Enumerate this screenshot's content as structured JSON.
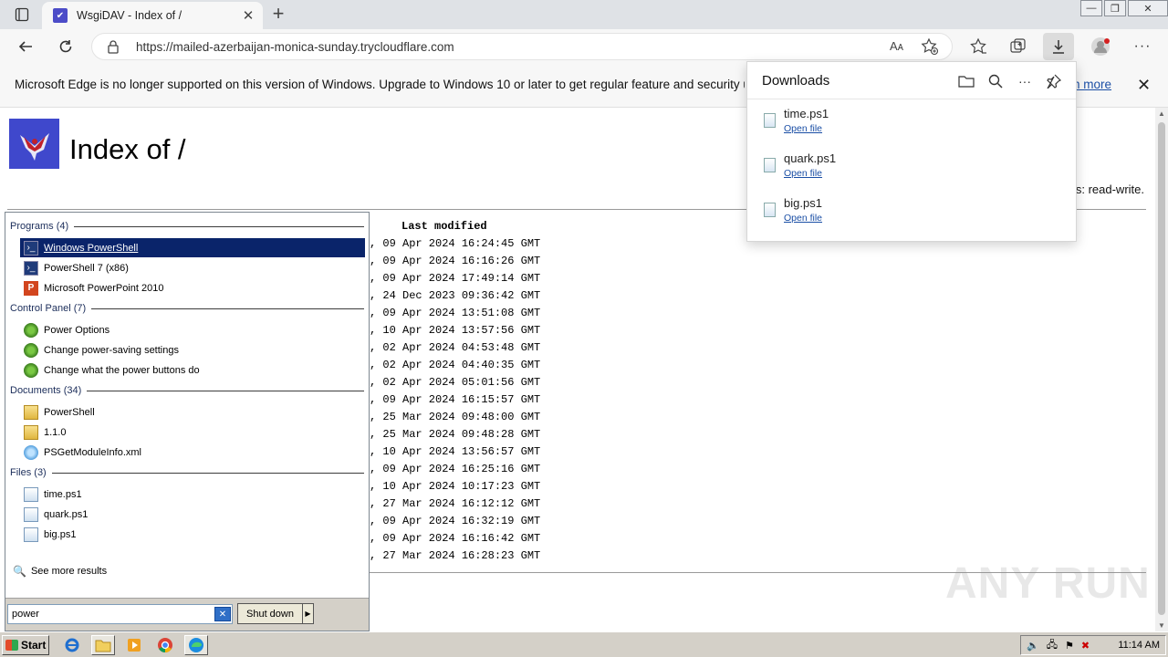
{
  "browser": {
    "tab_title": "WsgiDAV - Index of /",
    "url": "https://mailed-azerbaijan-monica-sunday.trycloudflare.com",
    "reader_label": "Aᴀ"
  },
  "infobar": {
    "message": "Microsoft Edge is no longer supported on this version of Windows. Upgrade to Windows 10 or later to get regular feature and security updates.",
    "learn_more": "arn more"
  },
  "page": {
    "title": "Index of /",
    "permission": "s: read-write.",
    "listing_header": "Last modified",
    "rows": [
      ", 09 Apr 2024 16:24:45 GMT",
      ", 09 Apr 2024 16:16:26 GMT",
      ", 09 Apr 2024 17:49:14 GMT",
      ", 24 Dec 2023 09:36:42 GMT",
      ", 09 Apr 2024 13:51:08 GMT",
      ", 10 Apr 2024 13:57:56 GMT",
      ", 02 Apr 2024 04:53:48 GMT",
      ", 02 Apr 2024 04:40:35 GMT",
      ", 02 Apr 2024 05:01:56 GMT",
      ", 09 Apr 2024 16:15:57 GMT",
      ", 25 Mar 2024 09:48:00 GMT",
      ", 25 Mar 2024 09:48:28 GMT",
      ", 10 Apr 2024 13:56:57 GMT",
      ", 09 Apr 2024 16:25:16 GMT",
      ", 10 Apr 2024 10:17:23 GMT",
      ", 27 Mar 2024 16:12:12 GMT",
      ", 09 Apr 2024 16:32:19 GMT",
      ", 09 Apr 2024 16:16:42 GMT",
      ", 27 Mar 2024 16:28:23 GMT"
    ]
  },
  "downloads": {
    "title": "Downloads",
    "items": [
      {
        "name": "time.ps1",
        "action": "Open file"
      },
      {
        "name": "quark.ps1",
        "action": "Open file"
      },
      {
        "name": "big.ps1",
        "action": "Open file"
      }
    ]
  },
  "startmenu": {
    "groups": {
      "programs": "Programs (4)",
      "control_panel": "Control Panel (7)",
      "documents": "Documents (34)",
      "files": "Files (3)"
    },
    "programs": [
      "Windows PowerShell",
      "PowerShell 7 (x86)",
      "Microsoft PowerPoint 2010"
    ],
    "control_panel": [
      "Power Options",
      "Change power-saving settings",
      "Change what the power buttons do"
    ],
    "documents": [
      "PowerShell",
      "1.1.0",
      "PSGetModuleInfo.xml"
    ],
    "files": [
      "time.ps1",
      "quark.ps1",
      "big.ps1"
    ],
    "see_more": "See more results",
    "search_value": "power",
    "shutdown_label": "Shut down"
  },
  "taskbar": {
    "start_label": "Start",
    "clock": "11:14 AM"
  },
  "watermark": "ANY RUN",
  "colors": {
    "selection": "#0a246a",
    "link": "#1a4ea5",
    "logo_bg": "#3f48cc"
  }
}
